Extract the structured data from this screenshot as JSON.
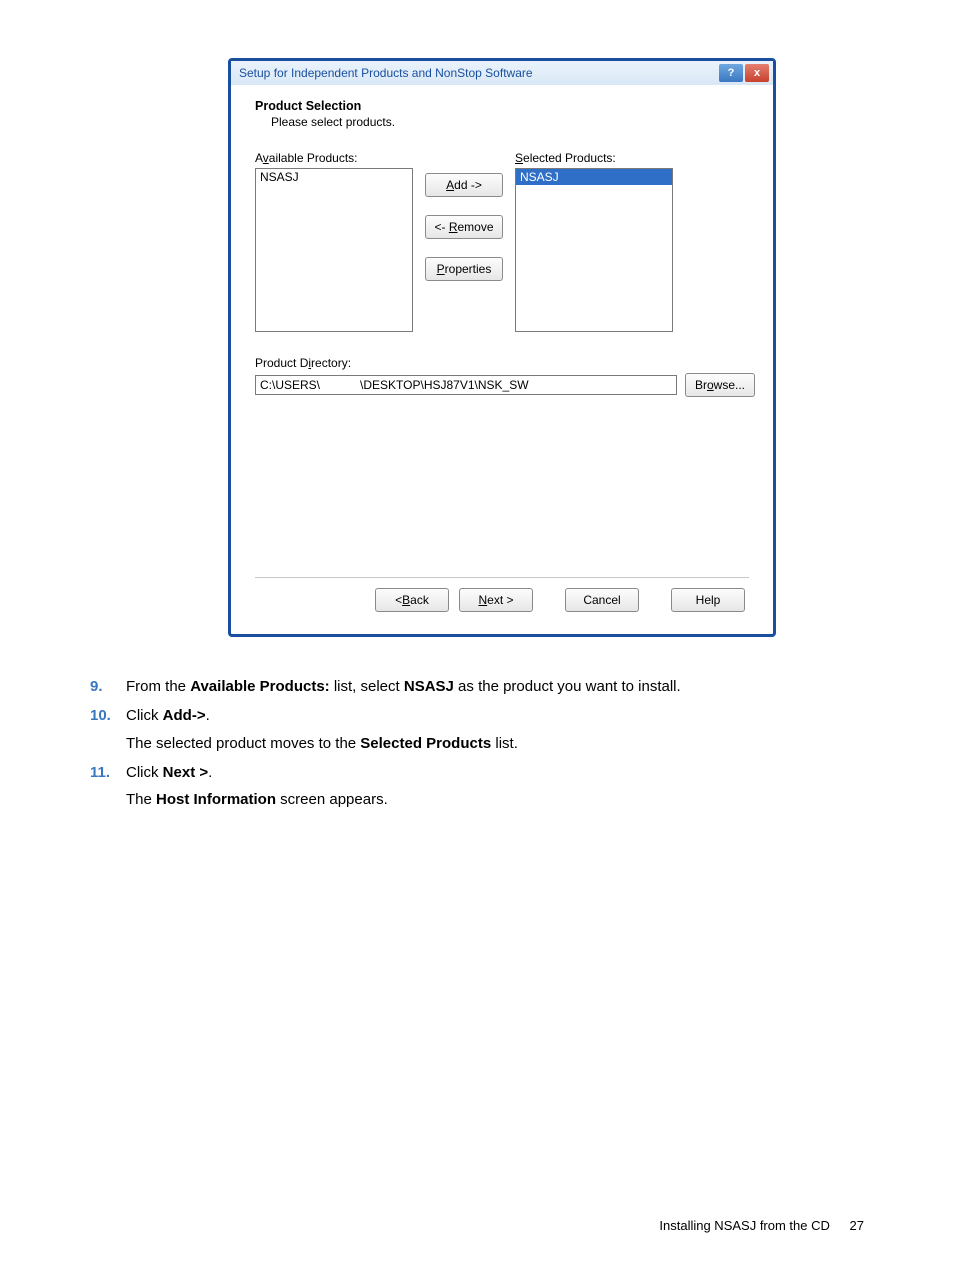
{
  "dialog": {
    "title": "Setup for Independent Products and NonStop Software",
    "heading": "Product Selection",
    "subheading": "Please select products.",
    "available_label": "Available Products:",
    "selected_label": "Selected Products:",
    "available_items": [
      "NSASJ"
    ],
    "selected_items": [
      "NSASJ"
    ],
    "add_btn": "Add ->",
    "remove_btn": "<- Remove",
    "properties_btn": "Properties",
    "dir_label": "Product Directory:",
    "dir_value": "C:\\USERS\\            \\DESKTOP\\HSJ87V1\\NSK_SW",
    "browse_btn": "Browse...",
    "back_btn": "< Back",
    "next_btn": "Next >",
    "cancel_btn": "Cancel",
    "help_btn": "Help"
  },
  "steps": {
    "s9_num": "9.",
    "s9_a": "From the ",
    "s9_b": "Available Products:",
    "s9_c": " list, select ",
    "s9_d": "NSASJ",
    "s9_e": " as the product you want to install.",
    "s10_num": "10.",
    "s10_a": "Click ",
    "s10_b": "Add->",
    "s10_c": ".",
    "s10_sub_a": "The selected product moves to the ",
    "s10_sub_b": "Selected Products",
    "s10_sub_c": " list.",
    "s11_num": "11.",
    "s11_a": "Click ",
    "s11_b": "Next >",
    "s11_c": ".",
    "s11_sub_a": "The ",
    "s11_sub_b": "Host Information",
    "s11_sub_c": " screen appears."
  },
  "footer": {
    "section": "Installing NSASJ from the CD",
    "page": "27"
  }
}
